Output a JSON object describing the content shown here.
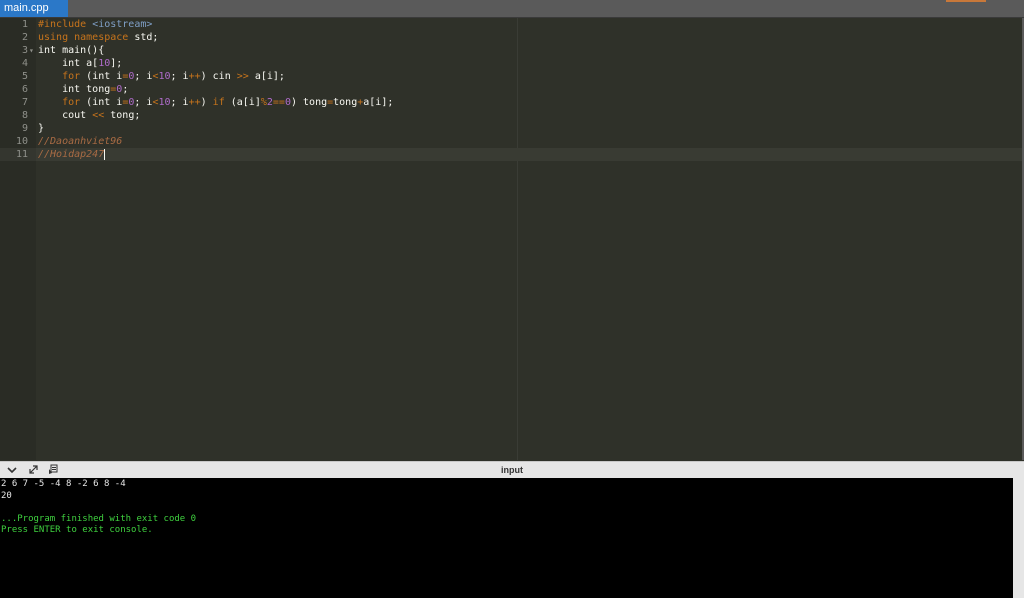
{
  "tab": {
    "label": "main.cpp"
  },
  "editor": {
    "lines": [
      {
        "num": "1",
        "tokens": [
          {
            "t": "#include ",
            "c": "kw"
          },
          {
            "t": "<iostream>",
            "c": "str"
          }
        ]
      },
      {
        "num": "2",
        "tokens": [
          {
            "t": "using namespace ",
            "c": "kw"
          },
          {
            "t": "std;",
            "c": ""
          }
        ]
      },
      {
        "num": "3",
        "fold": true,
        "tokens": [
          {
            "t": "int main(){",
            "c": ""
          }
        ]
      },
      {
        "num": "4",
        "tokens": [
          {
            "t": "    int a[",
            "c": ""
          },
          {
            "t": "10",
            "c": "num"
          },
          {
            "t": "];",
            "c": ""
          }
        ]
      },
      {
        "num": "5",
        "tokens": [
          {
            "t": "    ",
            "c": ""
          },
          {
            "t": "for",
            "c": "kw"
          },
          {
            "t": " (int i",
            "c": ""
          },
          {
            "t": "=",
            "c": "op"
          },
          {
            "t": "0",
            "c": "num"
          },
          {
            "t": "; i",
            "c": ""
          },
          {
            "t": "<",
            "c": "op"
          },
          {
            "t": "10",
            "c": "num"
          },
          {
            "t": "; i",
            "c": ""
          },
          {
            "t": "++",
            "c": "op"
          },
          {
            "t": ") cin ",
            "c": ""
          },
          {
            "t": ">>",
            "c": "op"
          },
          {
            "t": " a[i];",
            "c": ""
          }
        ]
      },
      {
        "num": "6",
        "tokens": [
          {
            "t": "    int tong",
            "c": ""
          },
          {
            "t": "=",
            "c": "op"
          },
          {
            "t": "0",
            "c": "num"
          },
          {
            "t": ";",
            "c": ""
          }
        ]
      },
      {
        "num": "7",
        "tokens": [
          {
            "t": "    ",
            "c": ""
          },
          {
            "t": "for",
            "c": "kw"
          },
          {
            "t": " (int i",
            "c": ""
          },
          {
            "t": "=",
            "c": "op"
          },
          {
            "t": "0",
            "c": "num"
          },
          {
            "t": "; i",
            "c": ""
          },
          {
            "t": "<",
            "c": "op"
          },
          {
            "t": "10",
            "c": "num"
          },
          {
            "t": "; i",
            "c": ""
          },
          {
            "t": "++",
            "c": "op"
          },
          {
            "t": ") ",
            "c": ""
          },
          {
            "t": "if",
            "c": "kw"
          },
          {
            "t": " (a[i]",
            "c": ""
          },
          {
            "t": "%",
            "c": "op"
          },
          {
            "t": "2",
            "c": "num"
          },
          {
            "t": "==",
            "c": "op"
          },
          {
            "t": "0",
            "c": "num"
          },
          {
            "t": ") tong",
            "c": ""
          },
          {
            "t": "=",
            "c": "op"
          },
          {
            "t": "tong",
            "c": ""
          },
          {
            "t": "+",
            "c": "op"
          },
          {
            "t": "a[i];",
            "c": ""
          }
        ]
      },
      {
        "num": "8",
        "tokens": [
          {
            "t": "    cout ",
            "c": ""
          },
          {
            "t": "<<",
            "c": "op"
          },
          {
            "t": " tong;",
            "c": ""
          }
        ]
      },
      {
        "num": "9",
        "tokens": [
          {
            "t": "}",
            "c": ""
          }
        ]
      },
      {
        "num": "10",
        "tokens": [
          {
            "t": "//Daoanhviet96",
            "c": "cmt"
          }
        ]
      },
      {
        "num": "11",
        "active": true,
        "cursor": true,
        "tokens": [
          {
            "t": "//Hoidap247",
            "c": "cmt"
          }
        ]
      }
    ]
  },
  "console": {
    "title": "input",
    "icons": [
      "chevron-down-icon",
      "expand-icon",
      "stdin-icon"
    ],
    "lines": [
      {
        "text": "2 6 7 -5 -4 8 -2 6 8 -4",
        "c": ""
      },
      {
        "text": "20",
        "c": ""
      },
      {
        "text": "",
        "c": ""
      },
      {
        "text": "...Program finished with exit code 0",
        "c": "green"
      },
      {
        "text": "Press ENTER to exit console.",
        "c": "green"
      }
    ]
  }
}
